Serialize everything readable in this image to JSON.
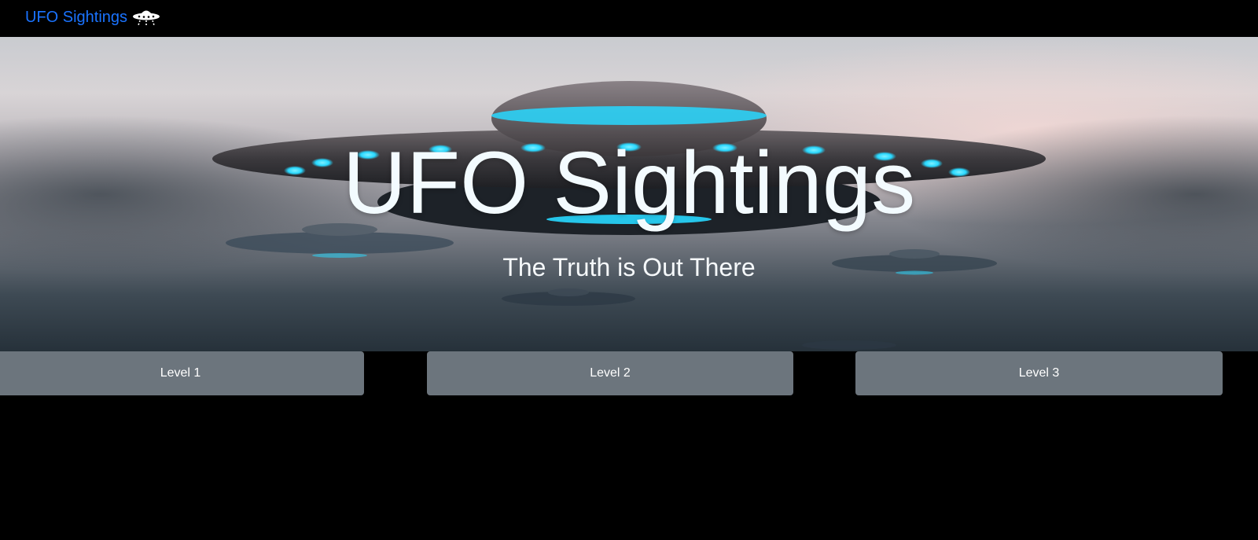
{
  "navbar": {
    "brand_label": "UFO Sightings",
    "brand_icon": "ufo-icon",
    "brand_color": "#1a73ff"
  },
  "hero": {
    "title": "UFO Sightings",
    "subtitle": "The Truth is Out There",
    "background_image": "ufo-fleet-in-cloudy-sky"
  },
  "levels": [
    {
      "label": "Level 1"
    },
    {
      "label": "Level 2"
    },
    {
      "label": "Level 3"
    }
  ],
  "colors": {
    "page_background": "#000000",
    "button_background": "#6c757d",
    "button_text": "#ffffff",
    "ufo_glow": "#28d8ff"
  }
}
